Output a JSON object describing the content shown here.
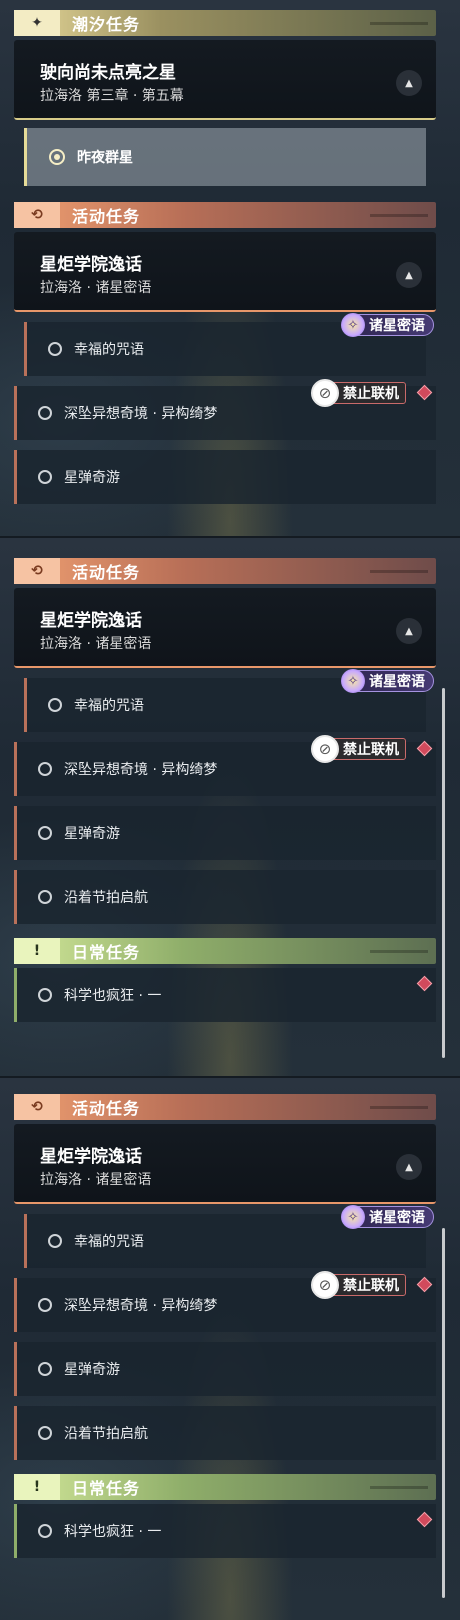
{
  "categories": {
    "tide": {
      "icon": "sparkle-icon",
      "glyph": "✦",
      "title": "潮汐任务"
    },
    "event": {
      "icon": "event-icon",
      "glyph": "⟲",
      "title": "活动任务"
    },
    "daily": {
      "icon": "exclamation-icon",
      "glyph": "!",
      "title": "日常任务"
    }
  },
  "tide_quest": {
    "title": "驶向尚未点亮之星",
    "subtitle": "拉海洛 第三章 · 第五幕",
    "selected_step": "昨夜群星"
  },
  "event_quest": {
    "title": "星炬学院逸话",
    "subtitle": "拉海洛 · 诸星密语",
    "steps": [
      "幸福的咒语",
      "深坠异想奇境 · 异构绮梦",
      "星弹奇游",
      "沿着节拍启航"
    ]
  },
  "daily_quest": {
    "steps": [
      "科学也疯狂 · 一"
    ]
  },
  "tags": {
    "stars": "诸星密语",
    "no_coop": "禁止联机"
  },
  "colors": {
    "tide_accent": "#e7d99a",
    "event_accent": "#f0a072",
    "daily_accent": "#d4e89a",
    "gem": "#d14a5c"
  }
}
